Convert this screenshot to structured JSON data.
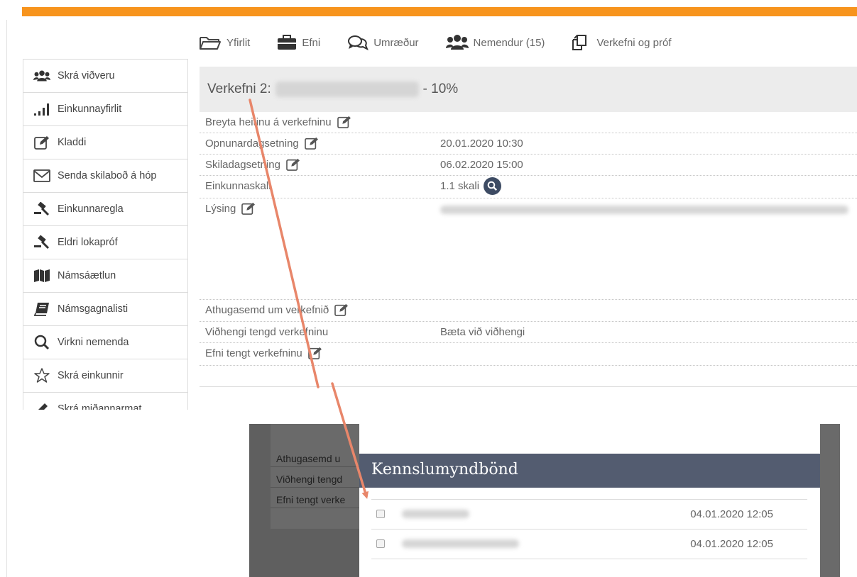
{
  "nav": {
    "items": [
      {
        "label": "Yfirlit",
        "icon": "folder-open-icon"
      },
      {
        "label": "Efni",
        "icon": "briefcase-icon"
      },
      {
        "label": "Umræður",
        "icon": "chat-bubbles-icon"
      },
      {
        "label": "Nemendur (15)",
        "icon": "users-icon"
      },
      {
        "label": "Verkefni og próf",
        "icon": "copy-icon"
      }
    ]
  },
  "sidebar": {
    "items": [
      {
        "label": "Skrá viðveru",
        "icon": "users-icon"
      },
      {
        "label": "Einkunnayfirlit",
        "icon": "signal-bars-icon"
      },
      {
        "label": "Kladdi",
        "icon": "edit-icon"
      },
      {
        "label": "Senda skilaboð á hóp",
        "icon": "envelope-icon"
      },
      {
        "label": "Einkunnaregla",
        "icon": "gavel-icon"
      },
      {
        "label": "Eldri lokapróf",
        "icon": "gavel-icon"
      },
      {
        "label": "Námsáætlun",
        "icon": "map-icon"
      },
      {
        "label": "Námsgagnalisti",
        "icon": "book-icon"
      },
      {
        "label": "Virkni nemenda",
        "icon": "search-icon"
      },
      {
        "label": "Skrá einkunnir",
        "icon": "star-icon"
      },
      {
        "label": "Skrá miðannarmat",
        "icon": "pencil-icon"
      }
    ]
  },
  "assignment": {
    "title_prefix": "Verkefni 2:",
    "title_suffix": "- 10%",
    "rows": [
      {
        "label": "Breyta heitinu á verkefninu",
        "value": "",
        "editable": true
      },
      {
        "label": "Opnunardagsetning",
        "value": "20.01.2020 10:30",
        "editable": true
      },
      {
        "label": "Skiladagsetning",
        "value": "06.02.2020 15:00",
        "editable": true
      },
      {
        "label": "Einkunnaskali",
        "value": "1.1 skali",
        "editable": false
      },
      {
        "label": "Lýsing",
        "value": "",
        "editable": true
      },
      {
        "label": "Athugasemd um verkefnið",
        "value": "",
        "editable": true
      },
      {
        "label": "Viðhengi tengd verkefninu",
        "value": "Bæta við viðhengi",
        "editable": false
      },
      {
        "label": "Efni tengt verkefninu",
        "value": "",
        "editable": true
      }
    ]
  },
  "overlay": {
    "background_rows": [
      "Athugasemd u",
      "Viðhengi tengd",
      "Efni tengt verke"
    ],
    "dialog": {
      "title": "Kennslumyndbönd",
      "items": [
        {
          "date": "04.01.2020 12:05"
        },
        {
          "date": "04.01.2020 12:05"
        }
      ]
    }
  },
  "colors": {
    "accent": "#f7941d",
    "dialog_header": "#535c70",
    "arrow": "#e8866a",
    "icon_dark": "#3d4b63"
  }
}
